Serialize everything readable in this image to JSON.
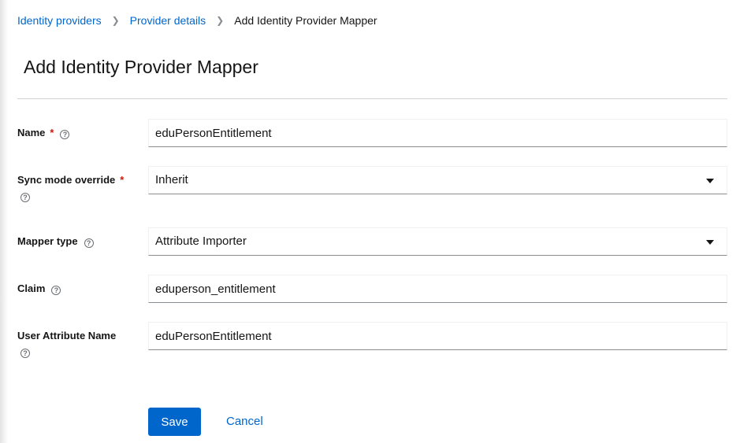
{
  "breadcrumb": [
    "Identity providers",
    "Provider details",
    "Add Identity Provider Mapper"
  ],
  "title": "Add Identity Provider Mapper",
  "fields": {
    "name": {
      "label": "Name",
      "value": "eduPersonEntitlement",
      "required": "*"
    },
    "sync": {
      "label": "Sync mode override",
      "value": "Inherit",
      "required": "*"
    },
    "mapper": {
      "label": "Mapper type",
      "value": "Attribute Importer"
    },
    "claim": {
      "label": "Claim",
      "value": "eduperson_entitlement"
    },
    "userattr": {
      "label": "User Attribute Name",
      "value": "eduPersonEntitlement"
    }
  },
  "help": "?",
  "actions": {
    "save": "Save",
    "cancel": "Cancel"
  }
}
